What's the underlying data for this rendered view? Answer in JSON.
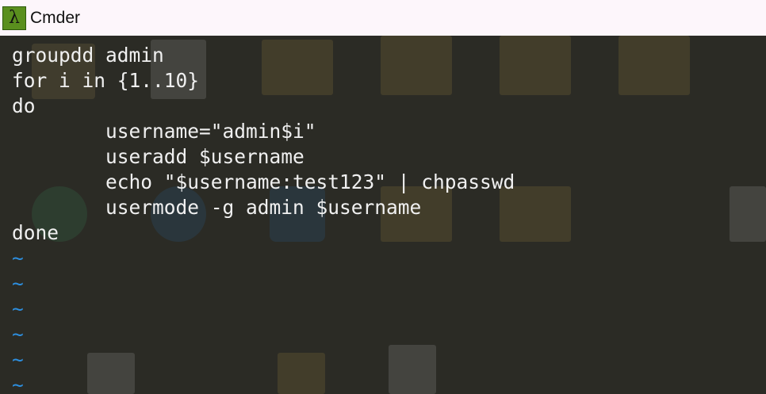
{
  "window": {
    "icon_glyph": "λ",
    "title": "Cmder"
  },
  "editor": {
    "lines": [
      "groupdd admin",
      "for i in {1..10}",
      "do",
      "        username=\"admin$i\"",
      "        useradd $username",
      "        echo \"$username:test123\" | chpasswd",
      "        usermode -g admin $username",
      "done"
    ],
    "empty_line_marker": "~",
    "empty_line_count": 6
  },
  "colors": {
    "titlebar_bg": "#fdf6fb",
    "terminal_bg": "#2b2b25",
    "text": "#f0f0f0",
    "tilde": "#2d8fe0",
    "icon_bg": "#5a8f1e"
  }
}
